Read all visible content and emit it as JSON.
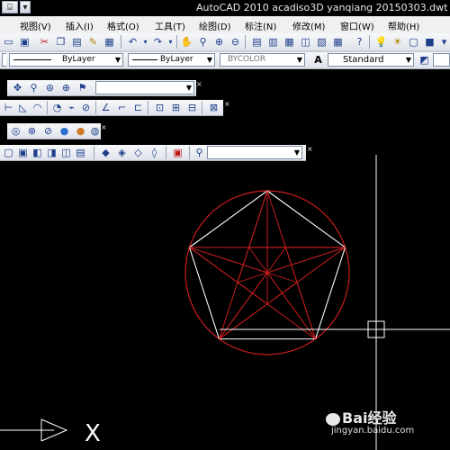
{
  "title_bar": {
    "title": "AutoCAD 2010    acadiso3D  yanqiang 20150303.dwt"
  },
  "menu": [
    "视图(V)",
    "插入(I)",
    "格式(O)",
    "工具(T)",
    "绘图(D)",
    "标注(N)",
    "修改(M)",
    "窗口(W)",
    "帮助(H)"
  ],
  "properties_toolbar": {
    "linetype": "ByLayer",
    "lineweight": "ByLayer",
    "color": "BYCOLOR",
    "text_style": "Standard"
  },
  "colors": {
    "canvas": "#000000",
    "circle": "#c81e1e",
    "pentagon": "#ffffff",
    "star": "#c81e1e",
    "crosshair": "#ffffff"
  },
  "drawing": {
    "shapes": [
      "circumscribed circle",
      "regular pentagon",
      "pentagram star"
    ],
    "crosshair_cursor": true,
    "ucs_axis_label": "X"
  },
  "watermark": {
    "brand": "Bai经验",
    "url": "jingyan.baidu.com"
  }
}
